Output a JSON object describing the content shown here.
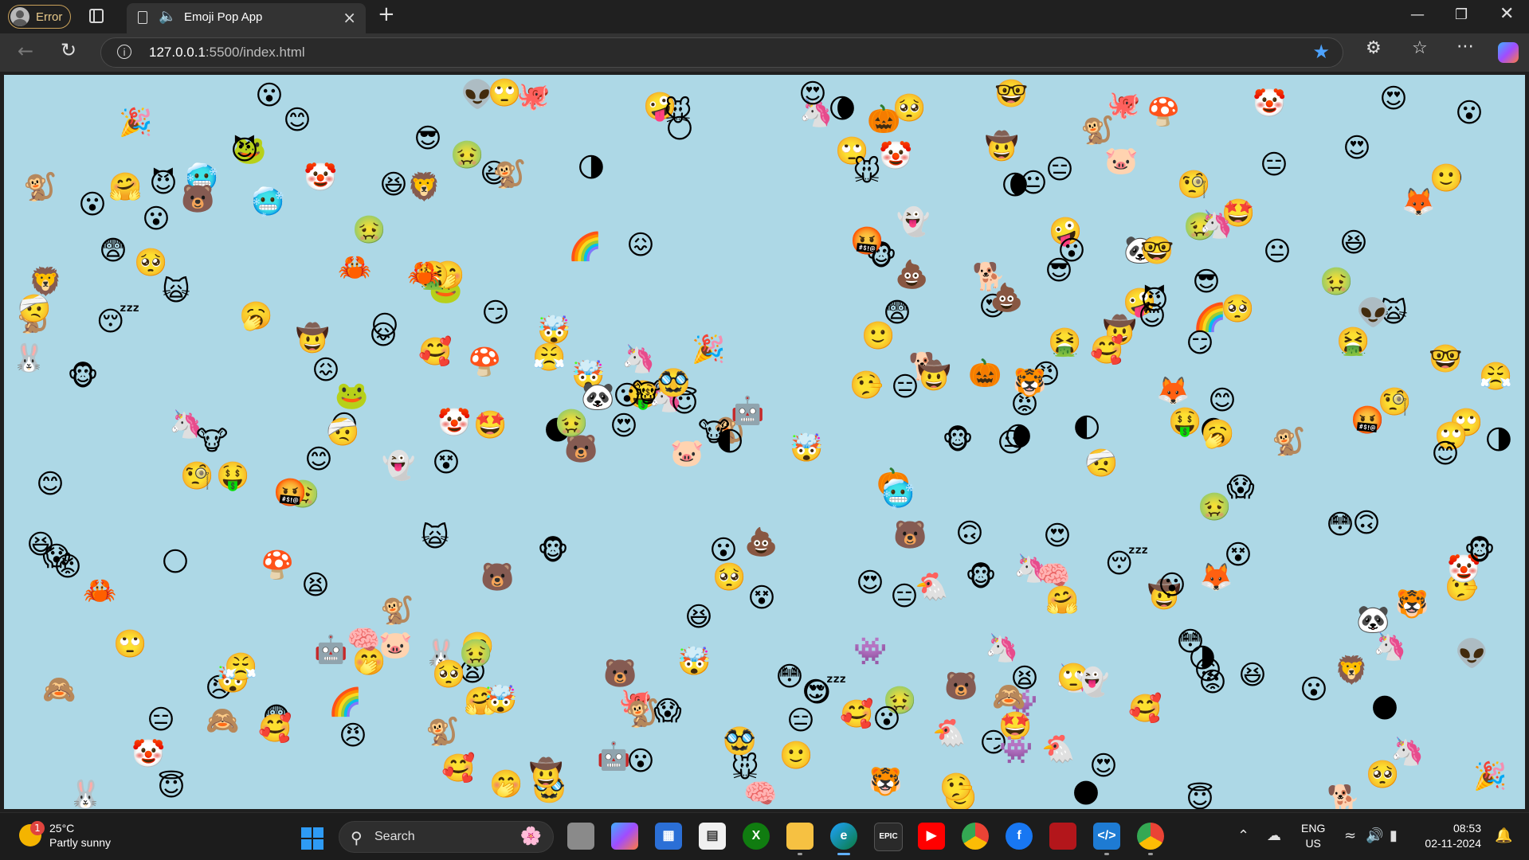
{
  "browser": {
    "profile_label": "Error",
    "tab_title": "Emoji Pop App",
    "url_host": "127.0.0.1",
    "url_rest": ":5500/index.html"
  },
  "emojis": [
    "😍",
    "🙂",
    "🦄",
    "😨",
    "🦄",
    "🤠",
    "🤢",
    "🐵",
    "🤖",
    "😮",
    "🦄",
    "🥰",
    "🥰",
    "🌑",
    "🤑",
    "🤩",
    "🥱",
    "🐻",
    "🙄",
    "🐼",
    "😱",
    "🥺",
    "😍",
    "😑",
    "🤡",
    "😠",
    "😎",
    "🤯",
    "😮",
    "🤪",
    "😆",
    "🤓",
    "🐸",
    "😖",
    "🌓",
    "😴",
    "🐔",
    "😊",
    "🐷",
    "💩",
    "🐭",
    "😊",
    "🙃",
    "😆",
    "🎃",
    "🦊",
    "🐰",
    "🌗",
    "🤢",
    "👾",
    "😍",
    "🤡",
    "🥺",
    "🤯",
    "🤗",
    "🤭",
    "😮",
    "🐒",
    "🙄",
    "😇",
    "🤢",
    "👽",
    "👻",
    "🐵",
    "🌘",
    "😏",
    "😐",
    "🤬",
    "😡",
    "🐻",
    "😤",
    "🌕",
    "🧐",
    "🤥",
    "😳",
    "🌈",
    "🐒",
    "🙈",
    "🐙",
    "🐕",
    "😈",
    "🥶",
    "🤠",
    "🤮",
    "😮",
    "🙀",
    "😑",
    "🥸",
    "🦀",
    "🐯",
    "🐒",
    "😫",
    "😵",
    "🤕",
    "🧠",
    "🦁",
    "🍄",
    "🐮",
    "🎉"
  ]
}
